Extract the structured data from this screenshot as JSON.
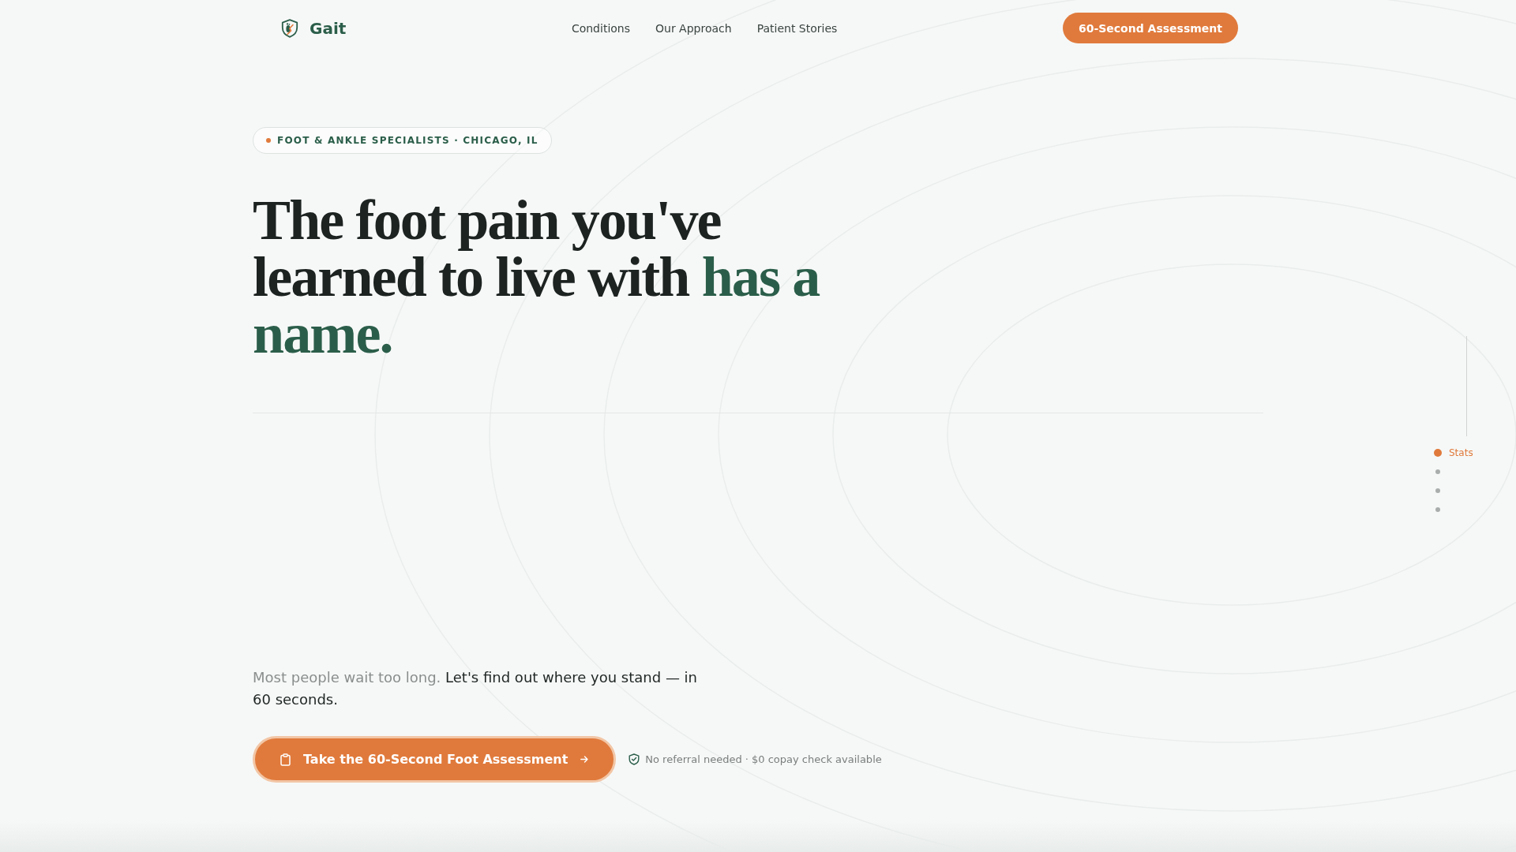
{
  "header": {
    "logo": "Gait",
    "nav_links": [
      "Conditions",
      "Our Approach",
      "Patient Stories"
    ],
    "cta_button": "60-Second Assessment"
  },
  "hero": {
    "eyebrow": "FOOT & ANKLE SPECIALISTS · CHICAGO, IL",
    "headline": [
      {
        "text": "The foot pain you've learned to live with ",
        "highlight": false
      },
      {
        "text": "has a name.",
        "highlight": true
      }
    ],
    "intro": [
      {
        "text": "Most people wait too long. ",
        "muted": true
      },
      {
        "text": "Let's find out where you stand — in 60 seconds.",
        "muted": false
      }
    ],
    "cta_button": "Take the 60-Second Foot Assessment",
    "note": "No referral needed · $0 copay check available"
  },
  "section_nav": [
    {
      "label": "Stats",
      "selected": true
    },
    {
      "selected": false
    },
    {
      "selected": false
    },
    {
      "selected": false
    }
  ]
}
